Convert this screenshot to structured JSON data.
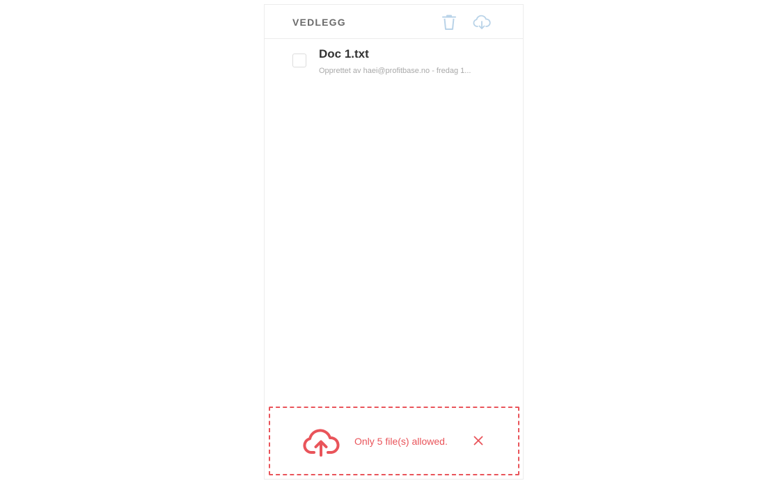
{
  "header": {
    "title": "VEDLEGG",
    "delete_icon": "trash-icon",
    "download_icon": "cloud-download-icon"
  },
  "files": [
    {
      "name": "Doc 1.txt",
      "meta": "Opprettet av haei@profitbase.no - fredag 1..."
    }
  ],
  "dropzone": {
    "icon": "cloud-upload-icon",
    "error_text": "Only 5 file(s) allowed.",
    "close_icon": "close-icon"
  },
  "colors": {
    "icon_muted": "#b9d3e8",
    "error": "#e9545a",
    "border": "#ececec"
  }
}
